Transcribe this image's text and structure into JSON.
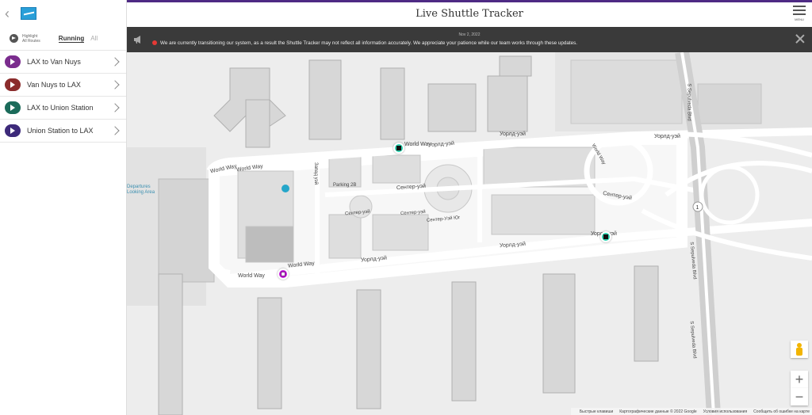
{
  "header": {
    "title": "Live Shuttle Tracker",
    "menu_label": "MENU"
  },
  "sidebar": {
    "filter": {
      "label_line1": "Highlight",
      "label_line2": "All Routes",
      "running": "Running",
      "all": "All"
    },
    "routes": [
      {
        "label": "LAX to Van Nuys",
        "color": "#7b2d8e"
      },
      {
        "label": "Van Nuys to LAX",
        "color": "#8b2c2c"
      },
      {
        "label": "LAX to Union Station",
        "color": "#1b6b5a"
      },
      {
        "label": "Union Station to LAX",
        "color": "#3d2a7a"
      }
    ]
  },
  "alert": {
    "date": "Nov 2, 2022",
    "message": "We are currently transitioning our system, as a result the Shuttle Tracker may not reflect all information accurately. We appreciate your patience while our team works through these updates."
  },
  "map": {
    "streets": [
      "World Way",
      "World Way",
      "World Way",
      "World Way",
      "World Way",
      "Уорлд-уэй",
      "Уорлд-уэй",
      "Уорлд-уэй",
      "Уорлд-уэй",
      "Уорлд-уэй",
      "Уорлд-уэй",
      "Сентер-уэй",
      "Сентер-уэй",
      "Сентер-уэй",
      "Сентер-уэй",
      "Parking 2B",
      "Сентер-Уэй Юг",
      "Запад уэй",
      "S Sepulveda Blvd",
      "S Sepulveda Blvd",
      "S Sepulveda Blvd",
      "World Way"
    ],
    "poi": [
      "Departures",
      "Looking Area"
    ],
    "shield_number": "1",
    "zoom_in": "+",
    "zoom_out": "−",
    "footer": [
      "Быстрые клавиши",
      "Картографические данные © 2022 Google",
      "Условия использования",
      "Сообщить об ошибке на карте"
    ]
  }
}
